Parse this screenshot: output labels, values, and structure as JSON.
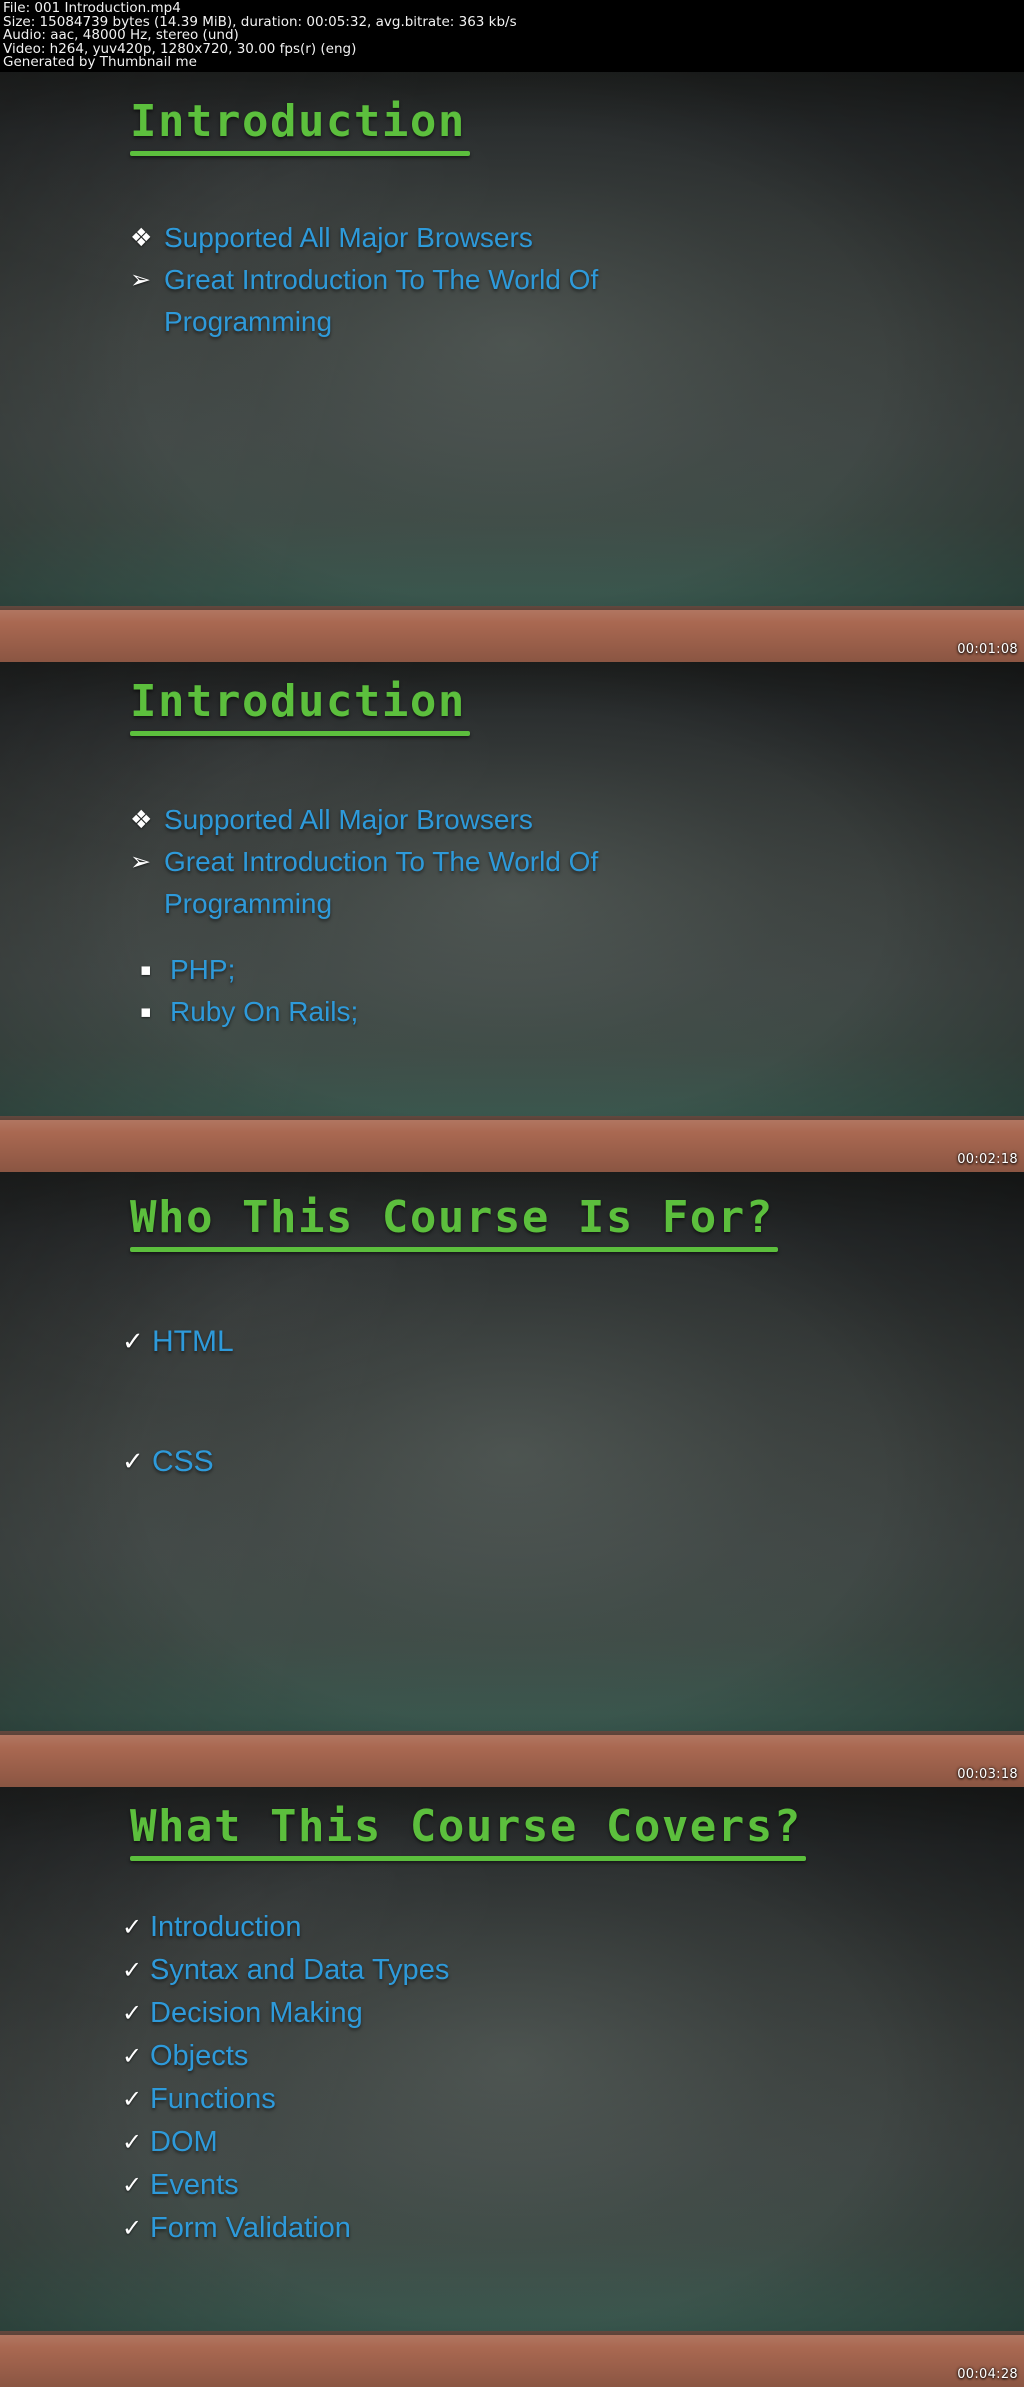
{
  "header": {
    "lines": [
      "File: 001 Introduction.mp4",
      "Size: 15084739 bytes (14.39 MiB), duration: 00:05:32, avg.bitrate: 363 kb/s",
      "Audio: aac, 48000 Hz, stereo (und)",
      "Video: h264, yuv420p, 1280x720, 30.00 fps(r) (eng)",
      "Generated by Thumbnail me"
    ]
  },
  "colors": {
    "title_green": "#5cbf3d",
    "bullet_blue": "#2e9ada",
    "board_dark": "#3a3f3d",
    "floor_wood": "#a4614a",
    "meta_text": "#f2f2f2"
  },
  "slides": [
    {
      "title": "Introduction",
      "timestamp": "00:01:08",
      "bullets": [
        {
          "mark": "❖",
          "text": "Supported All Major Browsers"
        },
        {
          "mark": "➢",
          "text": "Great Introduction To The World Of"
        },
        {
          "mark": "",
          "text": "Programming"
        }
      ]
    },
    {
      "title": "Introduction",
      "timestamp": "00:02:18",
      "bullets": [
        {
          "mark": "❖",
          "text": "Supported All Major Browsers"
        },
        {
          "mark": "➢",
          "text": "Great Introduction To The World Of"
        },
        {
          "mark": "",
          "text": "Programming"
        }
      ],
      "sub_bullets": [
        {
          "mark": "▪",
          "text": "PHP;"
        },
        {
          "mark": "▪",
          "text": "Ruby On Rails;"
        }
      ]
    },
    {
      "title": "Who This Course Is For?",
      "timestamp": "00:03:18",
      "bullets": [
        {
          "mark": "✓",
          "text": "HTML"
        },
        {
          "mark": "✓",
          "text": "CSS"
        }
      ]
    },
    {
      "title": "What This Course Covers?",
      "timestamp": "00:04:28",
      "bullets": [
        {
          "mark": "✓",
          "text": "Introduction"
        },
        {
          "mark": "✓",
          "text": "Syntax and Data Types"
        },
        {
          "mark": "✓",
          "text": "Decision Making"
        },
        {
          "mark": "✓",
          "text": "Objects"
        },
        {
          "mark": "✓",
          "text": "Functions"
        },
        {
          "mark": "✓",
          "text": "DOM"
        },
        {
          "mark": "✓",
          "text": "Events"
        },
        {
          "mark": "✓",
          "text": "Form Validation"
        }
      ]
    }
  ]
}
